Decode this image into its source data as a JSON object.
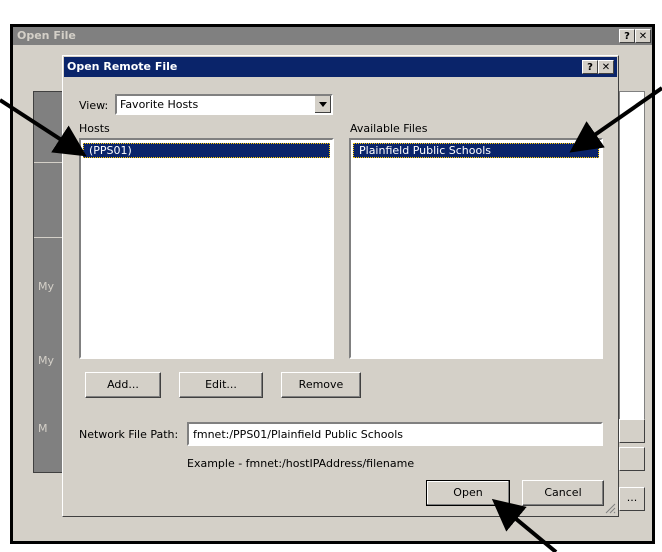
{
  "outer_window": {
    "title": "Open File",
    "help_button": "?",
    "close_button": "✕",
    "sidebar_labels": [
      "My",
      "My",
      "M"
    ],
    "browse_button": "..."
  },
  "dialog": {
    "title": "Open Remote File",
    "help_button": "?",
    "close_button": "✕",
    "view_label": "View:",
    "view_value": "Favorite Hosts",
    "hosts_label": "Hosts",
    "hosts": [
      "(PPS01)"
    ],
    "available_files_label": "Available Files",
    "available_files": [
      "Plainfield Public Schools"
    ],
    "add_button": "Add...",
    "edit_button": "Edit...",
    "remove_button": "Remove",
    "network_path_label": "Network File Path:",
    "network_path_value": "fmnet:/PPS01/Plainfield Public Schools",
    "example_text": "Example - fmnet:/hostIPAddress/filename",
    "open_button": "Open",
    "cancel_button": "Cancel"
  },
  "colors": {
    "title_active": "#0a246a",
    "title_inactive": "#808080",
    "face": "#d4d0c8"
  }
}
